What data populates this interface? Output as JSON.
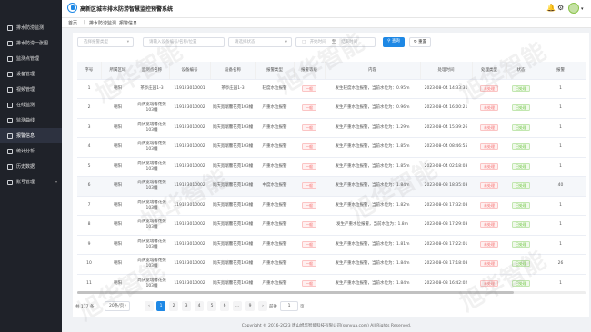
{
  "header": {
    "title": "高新区城市排水防涝智慧监控预警系统",
    "notifications_icon": "bell-icon",
    "settings_icon": "gear-icon"
  },
  "sidebar": {
    "items": [
      {
        "label": "排水防涝监测",
        "icon": "drop-icon"
      },
      {
        "label": "排水防涝一张图",
        "icon": "map-icon"
      },
      {
        "label": "监测点管理",
        "icon": "pin-icon"
      },
      {
        "label": "设备管理",
        "icon": "device-icon"
      },
      {
        "label": "视频管理",
        "icon": "video-icon"
      },
      {
        "label": "在线监测",
        "icon": "monitor-icon"
      },
      {
        "label": "监测曲线",
        "icon": "chart-icon"
      },
      {
        "label": "报警信息",
        "icon": "alarm-icon"
      },
      {
        "label": "统计分析",
        "icon": "stats-icon"
      },
      {
        "label": "历史数据",
        "icon": "history-icon"
      },
      {
        "label": "账号管理",
        "icon": "user-icon"
      }
    ]
  },
  "breadcrumb": {
    "home": "首页",
    "parent": "排水防涝监测",
    "current": "报警信息"
  },
  "filters": {
    "type_placeholder": "选择报警类型",
    "device_placeholder": "请输入设备编号/名称/位置",
    "status_placeholder": "请选择状态",
    "start_placeholder": "开始时间",
    "separator": "至",
    "end_placeholder": "结束时间",
    "search_label": "查询",
    "reset_label": "重置"
  },
  "table": {
    "columns": [
      "序号",
      "所属区域",
      "监测点名称",
      "设备编号",
      "设备名称",
      "报警类型",
      "报警等级",
      "内容",
      "处理时间",
      "处理类型",
      "状态",
      "报警"
    ],
    "rows": [
      {
        "index": "1",
        "region": "朝阳",
        "point": "茶亭庄园1-3",
        "device_no": "119123010001",
        "device_name": "茶亭庄园1-3",
        "type": "轻度水位报警",
        "level": "一般",
        "content": "发生轻度水位报警，当前水位为：0.95m",
        "time": "2023-08-04 14:33:31",
        "handle": "未处理",
        "status": "已处理",
        "count": "1"
      },
      {
        "index": "2",
        "region": "朝阳",
        "point": "尚庆宽瑞馨花苑103幢",
        "device_no": "119123010002",
        "device_name": "尚庆宽瑞馨花苑103幢",
        "type": "严重水位报警",
        "level": "一般",
        "content": "发生严重水位报警，当前水位为：0.96m",
        "time": "2023-08-04 16:00:21",
        "handle": "未处理",
        "status": "已处理",
        "count": "1"
      },
      {
        "index": "3",
        "region": "朝阳",
        "point": "尚庆宽瑞馨花苑103幢",
        "device_no": "119123010002",
        "device_name": "尚庆宽瑞馨花苑103幢",
        "type": "严重水位报警",
        "level": "一般",
        "content": "发生严重水位报警，当前水位为：1.29m",
        "time": "2023-08-04 15:39:26",
        "handle": "未处理",
        "status": "已处理",
        "count": "1"
      },
      {
        "index": "4",
        "region": "朝阳",
        "point": "尚庆宽瑞馨花苑103幢",
        "device_no": "119123010002",
        "device_name": "尚庆宽瑞馨花苑103幢",
        "type": "严重水位报警",
        "level": "一般",
        "content": "发生严重水位报警，当前水位为：1.85m",
        "time": "2023-08-04 08:46:55",
        "handle": "未处理",
        "status": "已处理",
        "count": "1"
      },
      {
        "index": "5",
        "region": "朝阳",
        "point": "尚庆宽瑞馨花苑103幢",
        "device_no": "119123010002",
        "device_name": "尚庆宽瑞馨花苑103幢",
        "type": "严重水位报警",
        "level": "一般",
        "content": "发生严重水位报警，当前水位为：1.85m",
        "time": "2023-08-04 02:18:03",
        "handle": "未处理",
        "status": "已处理",
        "count": "1"
      },
      {
        "index": "6",
        "region": "朝阳",
        "point": "尚庆宽瑞馨花苑103幢",
        "device_no": "119123010002",
        "device_name": "尚庆宽瑞馨花苑103幢",
        "type": "中度水位报警",
        "level": "一般",
        "content": "发生严重水位报警，当前水位为：1.84m",
        "time": "2023-08-03 18:35:03",
        "handle": "未处理",
        "status": "已处理",
        "count": "40"
      },
      {
        "index": "7",
        "region": "朝阳",
        "point": "尚庆宽瑞馨花苑103幢",
        "device_no": "119123010002",
        "device_name": "尚庆宽瑞馨花苑103幢",
        "type": "严重水位报警",
        "level": "一般",
        "content": "发生严重水位报警，当前水位为：1.82m",
        "time": "2023-08-03 17:32:08",
        "handle": "未处理",
        "status": "已处理",
        "count": "1"
      },
      {
        "index": "8",
        "region": "朝阳",
        "point": "尚庆宽瑞馨花苑103幢",
        "device_no": "119123010002",
        "device_name": "尚庆宽瑞馨花苑103幢",
        "type": "严重水位报警",
        "level": "一般",
        "content": "发生严重水位报警，当前水位为：1.8m",
        "time": "2023-08-03 17:29:03",
        "handle": "未处理",
        "status": "已处理",
        "count": "1"
      },
      {
        "index": "9",
        "region": "朝阳",
        "point": "尚庆宽瑞馨花苑103幢",
        "device_no": "119123010002",
        "device_name": "尚庆宽瑞馨花苑103幢",
        "type": "严重水位报警",
        "level": "一般",
        "content": "发生严重水位报警，当前水位为：1.81m",
        "time": "2023-08-03 17:22:01",
        "handle": "未处理",
        "status": "已处理",
        "count": "1"
      },
      {
        "index": "10",
        "region": "朝阳",
        "point": "尚庆宽瑞馨花苑103幢",
        "device_no": "119123010002",
        "device_name": "尚庆宽瑞馨花苑103幢",
        "type": "严重水位报警",
        "level": "一般",
        "content": "发生严重水位报警，当前水位为：1.84m",
        "time": "2023-08-03 17:18:08",
        "handle": "未处理",
        "status": "已处理",
        "count": "26"
      },
      {
        "index": "11",
        "region": "朝阳",
        "point": "尚庆宽瑞馨花苑103幢",
        "device_no": "119123010002",
        "device_name": "尚庆宽瑞馨花苑103幢",
        "type": "严重水位报警",
        "level": "一般",
        "content": "发生严重水位报警，当前水位为：1.84m",
        "time": "2023-08-03 16:42:02",
        "handle": "未处理",
        "status": "已处理",
        "count": "1"
      }
    ]
  },
  "pagination": {
    "total": "共 177 条",
    "page_size": "20条/页",
    "prev": "‹",
    "pages": [
      "1",
      "2",
      "3",
      "4",
      "5",
      "6",
      "…",
      "9"
    ],
    "next": "›",
    "goto_label": "前往",
    "goto_value": "1",
    "page_suffix": "页"
  },
  "footer": {
    "copyright": "Copyright © 2016-2023 唐山旭华智能科技有限公司(sunvua.com) All Rights Reserved."
  },
  "watermark": "旭华智能",
  "colors": {
    "primary": "#1e88e5",
    "sidebar": "#1f2229",
    "danger": "#f56c6c",
    "success": "#67c23a"
  }
}
